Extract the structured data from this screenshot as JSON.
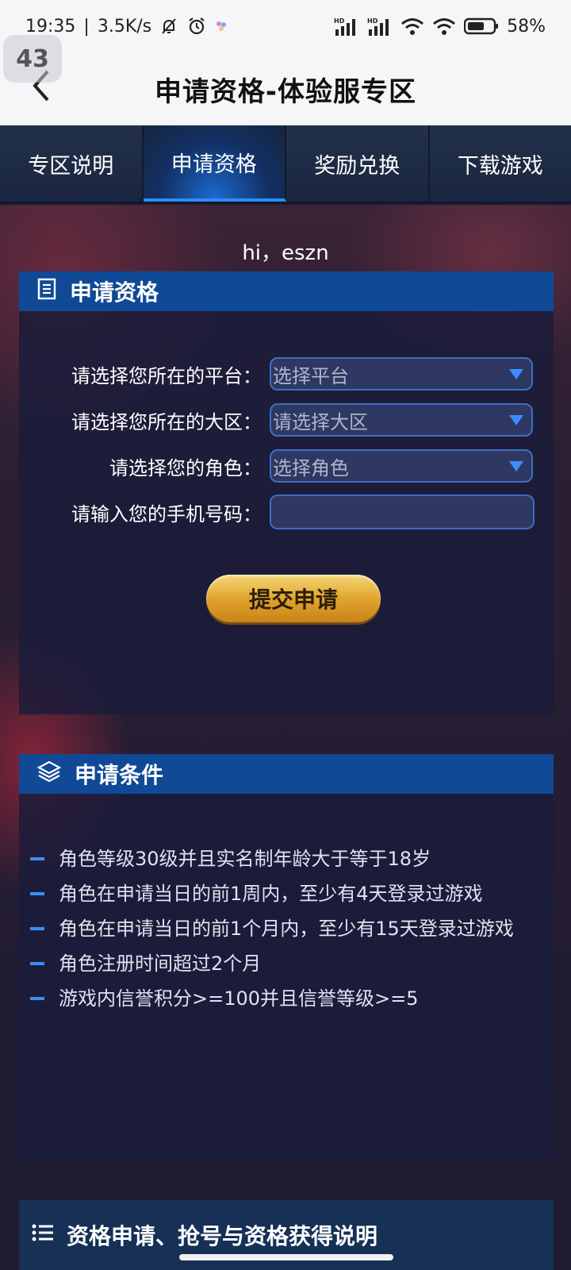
{
  "status_bar": {
    "time": "19:35",
    "speed": "3.5K/s",
    "battery": "58%",
    "icons": [
      "bell-off-icon",
      "alarm-icon",
      "dots-icon",
      "signal-icon",
      "signal-icon",
      "wifi-icon",
      "wifi-icon",
      "battery-icon"
    ]
  },
  "header": {
    "title": "申请资格-体验服专区",
    "back_badge": "43"
  },
  "tabs": [
    {
      "label": "专区说明",
      "active": false
    },
    {
      "label": "申请资格",
      "active": true
    },
    {
      "label": "奖励兑换",
      "active": false
    },
    {
      "label": "下载游戏",
      "active": false
    }
  ],
  "greeting": "hi，eszn",
  "apply_panel": {
    "title": "申请资格",
    "rows": [
      {
        "label": "请选择您所在的平台：",
        "value": "选择平台"
      },
      {
        "label": "请选择您所在的大区：",
        "value": "请选择大区"
      },
      {
        "label": "请选择您的角色：",
        "value": "选择角色"
      }
    ],
    "phone_label": "请输入您的手机号码：",
    "phone_value": "",
    "submit_label": "提交申请"
  },
  "conditions_panel": {
    "title": "申请条件",
    "items": [
      "角色等级30级并且实名制年龄大于等于18岁",
      "角色在申请当日的前1周内，至少有4天登录过游戏",
      "角色在申请当日的前1个月内，至少有15天登录过游戏",
      "角色注册时间超过2个月",
      "游戏内信誉积分>=100并且信誉等级>=5"
    ]
  },
  "explain_panel": {
    "title": "资格申请、抢号与资格获得说明"
  },
  "colors": {
    "accent": "#104a96",
    "highlight": "#3d8cff",
    "button_gold": "#e0a52c"
  }
}
